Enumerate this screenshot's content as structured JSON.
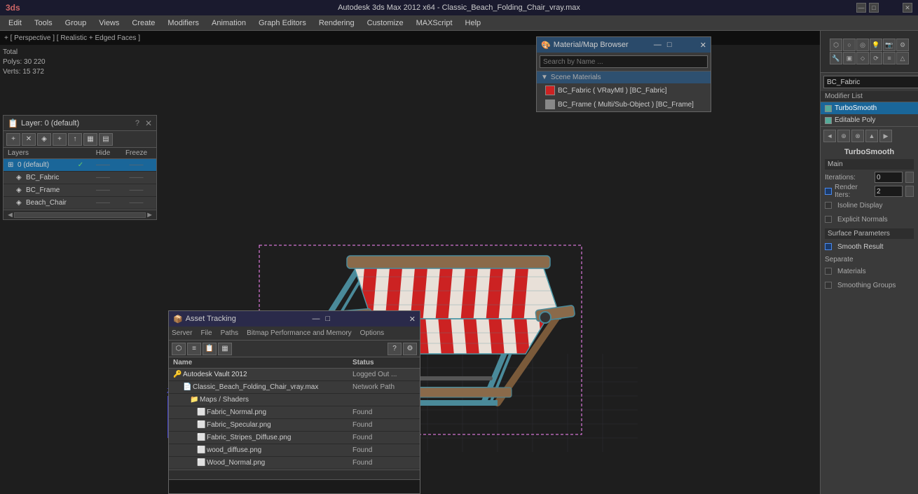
{
  "titleBar": {
    "appIcon": "3ds",
    "title": "Autodesk 3ds Max 2012 x64 - Classic_Beach_Folding_Chair_vray.max",
    "winControls": [
      "_",
      "□",
      "✕"
    ]
  },
  "menuBar": {
    "items": [
      "Edit",
      "Tools",
      "Group",
      "Views",
      "Create",
      "Modifiers",
      "Animation",
      "Graph Editors",
      "Rendering",
      "Customize",
      "MAXScript",
      "Help"
    ]
  },
  "viewport": {
    "label": "+ [ Perspective ] [ Realistic + Edged Faces ]",
    "stats": {
      "total": "Total",
      "polys_label": "Polys:",
      "polys_value": "30 220",
      "verts_label": "Verts:",
      "verts_value": "15 372"
    }
  },
  "layersPanel": {
    "title": "Layer: 0 (default)",
    "icon": "📋",
    "columns": {
      "name": "Layers",
      "hide": "Hide",
      "freeze": "Freeze"
    },
    "layers": [
      {
        "indent": 0,
        "icon": "⊞",
        "name": "0 (default)",
        "check": "✓",
        "selected": true
      },
      {
        "indent": 1,
        "icon": "◈",
        "name": "BC_Fabric",
        "check": "",
        "selected": false
      },
      {
        "indent": 1,
        "icon": "◈",
        "name": "BC_Frame",
        "check": "",
        "selected": false
      },
      {
        "indent": 1,
        "icon": "◈",
        "name": "Beach_Chair",
        "check": "",
        "selected": false
      }
    ]
  },
  "rightPanel": {
    "label": "BC_Fabric",
    "modifierListLabel": "Modifier List",
    "modifiers": [
      {
        "name": "TurboSmooth",
        "active": true,
        "checked": true
      },
      {
        "name": "Editable Poly",
        "active": false,
        "checked": true
      }
    ],
    "turboSmooth": {
      "title": "TurboSmooth",
      "mainLabel": "Main",
      "rows": [
        {
          "label": "Iterations:",
          "value": "0"
        },
        {
          "label": "Render Iters:",
          "value": "2",
          "checkbox": true
        }
      ],
      "checkboxes": [
        {
          "label": "Isoline Display",
          "checked": false
        },
        {
          "label": "Explicit Normals",
          "checked": false
        }
      ],
      "surfaceParams": {
        "label": "Surface Parameters",
        "checkboxes": [
          {
            "label": "Smooth Result",
            "checked": true
          }
        ],
        "separateLabel": "Separate",
        "separateItems": [
          {
            "label": "Materials",
            "checked": false
          },
          {
            "label": "Smoothing Groups",
            "checked": false
          }
        ]
      }
    }
  },
  "matBrowser": {
    "title": "Material/Map Browser",
    "searchPlaceholder": "Search by Name ...",
    "sceneMaterials": "Scene Materials",
    "materials": [
      {
        "name": "BC_Fabric ( VRayMtl ) [BC_Fabric]",
        "color": "#cc2222"
      },
      {
        "name": "BC_Frame ( Multi/Sub-Object ) [BC_Frame]",
        "color": "#888888"
      }
    ]
  },
  "assetTracking": {
    "title": "Asset Tracking",
    "menuItems": [
      "Server",
      "File",
      "Paths",
      "Bitmap Performance and Memory",
      "Options"
    ],
    "columns": {
      "name": "Name",
      "status": "Status"
    },
    "items": [
      {
        "indent": 0,
        "icon": "🔑",
        "name": "Autodesk Vault 2012",
        "status": "Logged Out ...",
        "isParent": true
      },
      {
        "indent": 1,
        "icon": "📄",
        "name": "Classic_Beach_Folding_Chair_vray.max",
        "status": "Network Path",
        "isParent": false
      },
      {
        "indent": 2,
        "icon": "📁",
        "name": "Maps / Shaders",
        "status": "",
        "isParent": false
      },
      {
        "indent": 3,
        "icon": "🖼",
        "name": "Fabric_Normal.png",
        "status": "Found",
        "isParent": false
      },
      {
        "indent": 3,
        "icon": "🖼",
        "name": "Fabric_Specular.png",
        "status": "Found",
        "isParent": false
      },
      {
        "indent": 3,
        "icon": "🖼",
        "name": "Fabric_Stripes_Diffuse.png",
        "status": "Found",
        "isParent": false
      },
      {
        "indent": 3,
        "icon": "🖼",
        "name": "wood_diffuse.png",
        "status": "Found",
        "isParent": false
      },
      {
        "indent": 3,
        "icon": "🖼",
        "name": "Wood_Normal.png",
        "status": "Found",
        "isParent": false
      }
    ]
  },
  "icons": {
    "search": "🔍",
    "gear": "⚙",
    "close": "✕",
    "minimize": "—",
    "maximize": "□",
    "layer": "◈",
    "folder": "📁",
    "file": "📄",
    "image": "🖼",
    "key": "🔑"
  }
}
